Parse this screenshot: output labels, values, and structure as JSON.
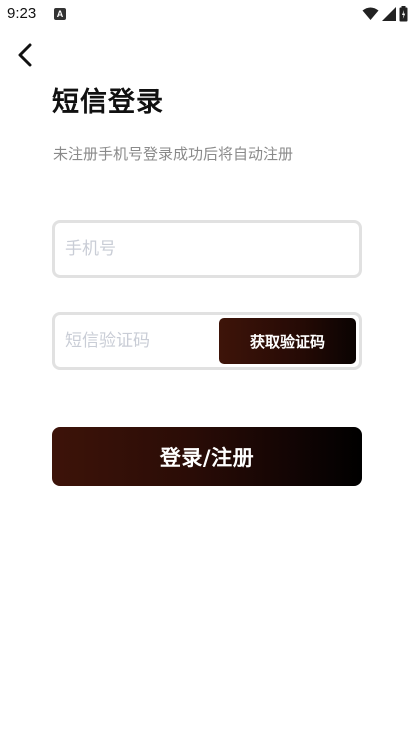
{
  "status_bar": {
    "time": "9:23",
    "app_icon_letter": "A",
    "icons": [
      "wifi-icon",
      "signal-icon",
      "battery-icon"
    ]
  },
  "header": {
    "back_icon": "chevron-left-icon",
    "title": "短信登录",
    "subtitle": "未注册手机号登录成功后将自动注册"
  },
  "form": {
    "phone": {
      "placeholder": "手机号",
      "value": ""
    },
    "code": {
      "placeholder": "短信验证码",
      "value": ""
    },
    "get_code_label": "获取验证码",
    "submit_label": "登录/注册"
  },
  "colors": {
    "primary_dark": "#000000",
    "primary_brown": "#3e1409",
    "field_border": "#e1e1e1",
    "placeholder": "#c9cdd6",
    "subtitle": "#8a8a8a"
  }
}
